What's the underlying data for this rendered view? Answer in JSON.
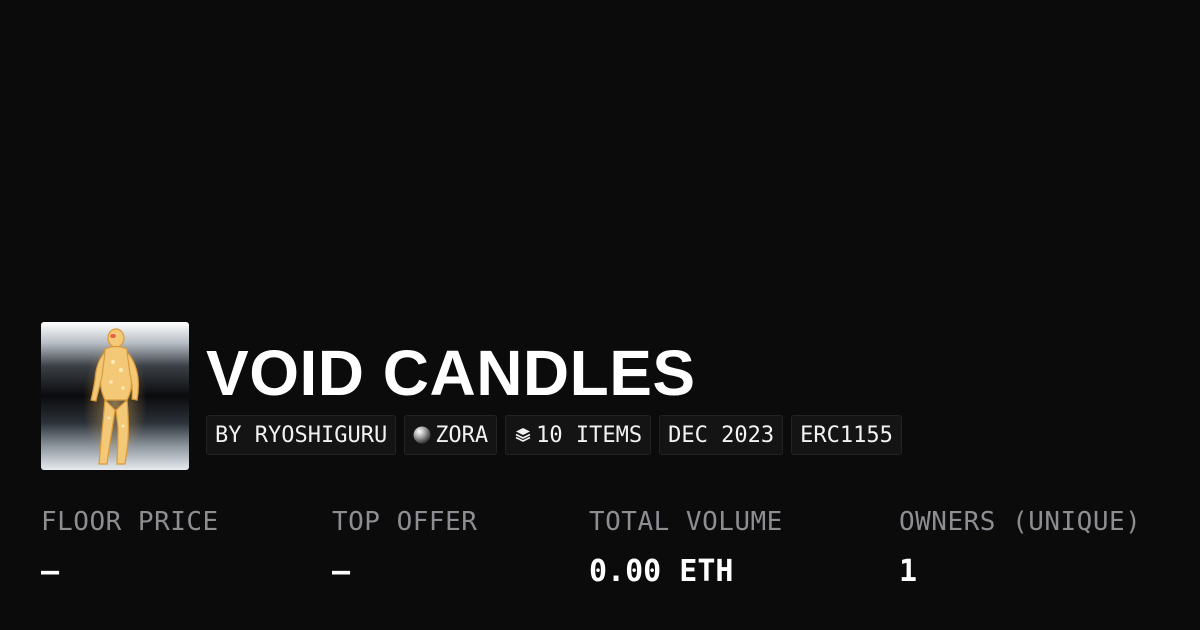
{
  "collection": {
    "title": "VOID CANDLES"
  },
  "tags": [
    {
      "label": "BY RYOSHIGURU"
    },
    {
      "label": "ZORA",
      "icon": "zora-orb-icon"
    },
    {
      "label": "10 ITEMS",
      "icon": "layers-icon"
    },
    {
      "label": "DEC 2023"
    },
    {
      "label": "ERC1155"
    }
  ],
  "stats": [
    {
      "label": "FLOOR PRICE",
      "value": "–"
    },
    {
      "label": "TOP OFFER",
      "value": "–"
    },
    {
      "label": "TOTAL VOLUME",
      "value": "0.00 ETH"
    },
    {
      "label": "OWNERS (UNIQUE)",
      "value": "1"
    }
  ],
  "colors": {
    "background": "#0b0b0c",
    "text": "#ffffff",
    "muted": "#8d8d92",
    "tag_bg": "#141415"
  }
}
